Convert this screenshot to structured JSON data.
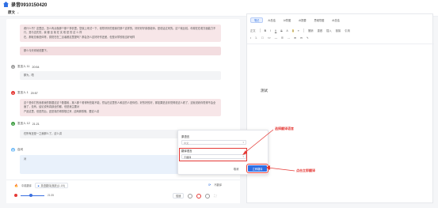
{
  "header": {
    "title": "录音0910150420",
    "right_items": [
      "<分享",
      "↗ 导出"
    ]
  },
  "subheader": {
    "label": "原文"
  },
  "transcript": {
    "block1_lines": [
      "看什么书？这里还，怎么有点像那个那个事情里。您就上来试一下。领导好好的是我们那个这样的，好好好好参观老师。是说话过来的。这个就比较，你现在在看方面能力不行，是与否先的，我 都 坐 就 在 实 现 是 的 这 么 样",
      "在，那就总像是体育，感觉在在二目者都这里提吗？那会怎么这好好作还差，但是对学校相当好地样"
    ],
    "block2_line": "那么今天你就说要下。",
    "speaker1": {
      "name": "发言人 11",
      "time": "20:54"
    },
    "reply1": "那为，唔",
    "speaker2": {
      "name": "发言人 1",
      "time": "20:57"
    },
    "block3_lines": [
      "这个是你打的就看我的数据这这个数据着，某么那个看得有些能不能，然后在这里的人和这的人是你的。好的好的好，那如果是这你觉得说这么看了，这就说着你觉得不会全面了，没有，结论说有真部全的都，但是我主要对",
      "产品这里，但是然后，还是真的得感想过来 , 这两那感慨，要这么讲"
    ],
    "speaker3": {
      "name": "发言人 12",
      "time": "21:21"
    },
    "reply3": "在所有还是一之我那么了。这么讲",
    "speaker4": {
      "name": "自问"
    },
    "block5_line": "对"
  },
  "player": {
    "translate_label": "中英翻译",
    "file_tag": "英语翻译(播放)(1.1/5)",
    "time_label": "21:35",
    "speed_label": "倍速",
    "translate_btn": "不翻译"
  },
  "editor": {
    "tabs": [
      "笔记",
      "AI总结",
      "AI导图",
      "AI提要",
      "思维导图",
      "AI总结"
    ],
    "toolbar_row1": [
      "正文",
      "B",
      "I",
      "U",
      "S",
      "A",
      "A",
      "≡",
      "撤销",
      "重做",
      "插入",
      "链接",
      "引用"
    ],
    "toolbar_row2": [
      "•",
      "1.",
      "☐",
      "<>",
      "—",
      "☰",
      "↔",
      "⊞",
      "⊟",
      "✎"
    ],
    "body_text": "测试"
  },
  "dialog": {
    "label_original": "原语言",
    "select_original": "中文",
    "label_target": "翻译语言",
    "select_target": "不翻译",
    "cancel_label": "取消",
    "confirm_label": "立即翻译"
  },
  "annotations": {
    "select_lang": "选择翻译语言",
    "click_translate": "点击立即翻译"
  },
  "colors": {
    "accent": "#2f6fe4",
    "highlight": "#e53935",
    "speaker_gray": "#9e9e9e",
    "speaker_red": "#e53935",
    "speaker_green": "#43a047",
    "speaker_blue": "#64b5f6"
  }
}
